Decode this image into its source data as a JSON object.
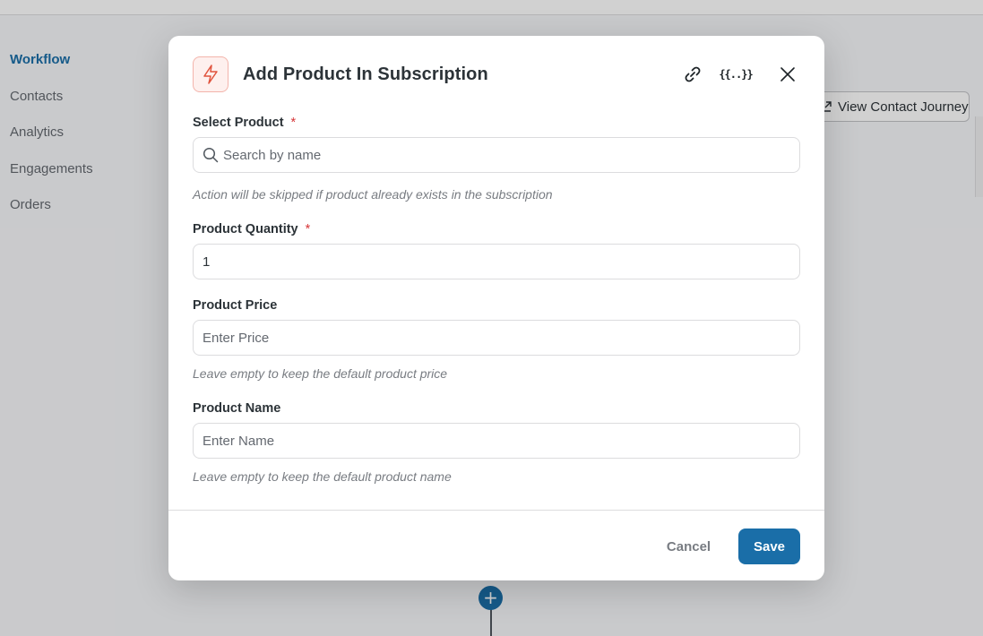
{
  "sidebar": {
    "items": [
      {
        "label": "Workflow"
      },
      {
        "label": "Contacts"
      },
      {
        "label": "Analytics"
      },
      {
        "label": "Engagements"
      },
      {
        "label": "Orders"
      }
    ]
  },
  "toolbar": {
    "journey_label": "View Contact Journey",
    "journey_icon": "external-link-icon"
  },
  "flow": {
    "add_step_icon": "+"
  },
  "modal": {
    "title": "Add Product In Subscription",
    "action_icon": "bolt-icon",
    "header_icons": [
      "link-icon",
      "merge-tags-icon",
      "close-icon"
    ],
    "merge_tags_glyph": "{{..}}",
    "fields": {
      "select_product": {
        "label": "Select Product",
        "required_mark": "*",
        "placeholder": "Search by name",
        "value": "",
        "help": "Action will be skipped if product already exists in the subscription"
      },
      "product_quantity": {
        "label": "Product Quantity",
        "required_mark": "*",
        "value": "1"
      },
      "product_price": {
        "label": "Product Price",
        "placeholder": "Enter Price",
        "value": "",
        "help": "Leave empty to keep the default product price"
      },
      "product_name": {
        "label": "Product Name",
        "placeholder": "Enter Name",
        "value": "",
        "help": "Leave empty to keep the default product name"
      }
    },
    "footer": {
      "cancel_label": "Cancel",
      "save_label": "Save"
    }
  },
  "colors": {
    "accent": "#1a6ea8",
    "required": "#d63638",
    "action_icon": "#e0533d"
  }
}
